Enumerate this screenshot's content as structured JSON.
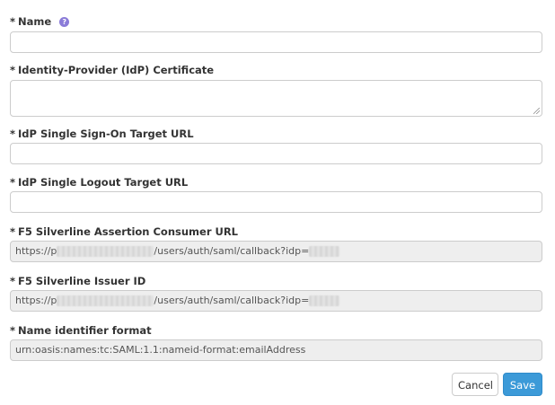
{
  "form": {
    "required_marker": "*",
    "name": {
      "label": "Name",
      "value": ""
    },
    "certificate": {
      "label": "Identity-Provider (IdP) Certificate",
      "value": ""
    },
    "sso_url": {
      "label": "IdP Single Sign-On Target URL",
      "value": ""
    },
    "logout_url": {
      "label": "IdP Single Logout Target URL",
      "value": ""
    },
    "acs_url": {
      "label": "F5 Silverline Assertion Consumer URL",
      "value_prefix": "https://p",
      "value_middle": "/users/auth/saml/callback?idp=",
      "value_suffix": ""
    },
    "issuer_id": {
      "label": "F5 Silverline Issuer ID",
      "value_prefix": "https://p",
      "value_middle": "/users/auth/saml/callback?idp=",
      "value_suffix": ""
    },
    "name_id_format": {
      "label": "Name identifier format",
      "value": "urn:oasis:names:tc:SAML:1.1:nameid-format:emailAddress"
    }
  },
  "buttons": {
    "cancel": "Cancel",
    "save": "Save"
  },
  "icons": {
    "help": "question-circle-icon"
  },
  "colors": {
    "save_button": "#3c9ad8",
    "help_icon": "#8a7bd8",
    "readonly_bg": "#eeeeee"
  }
}
